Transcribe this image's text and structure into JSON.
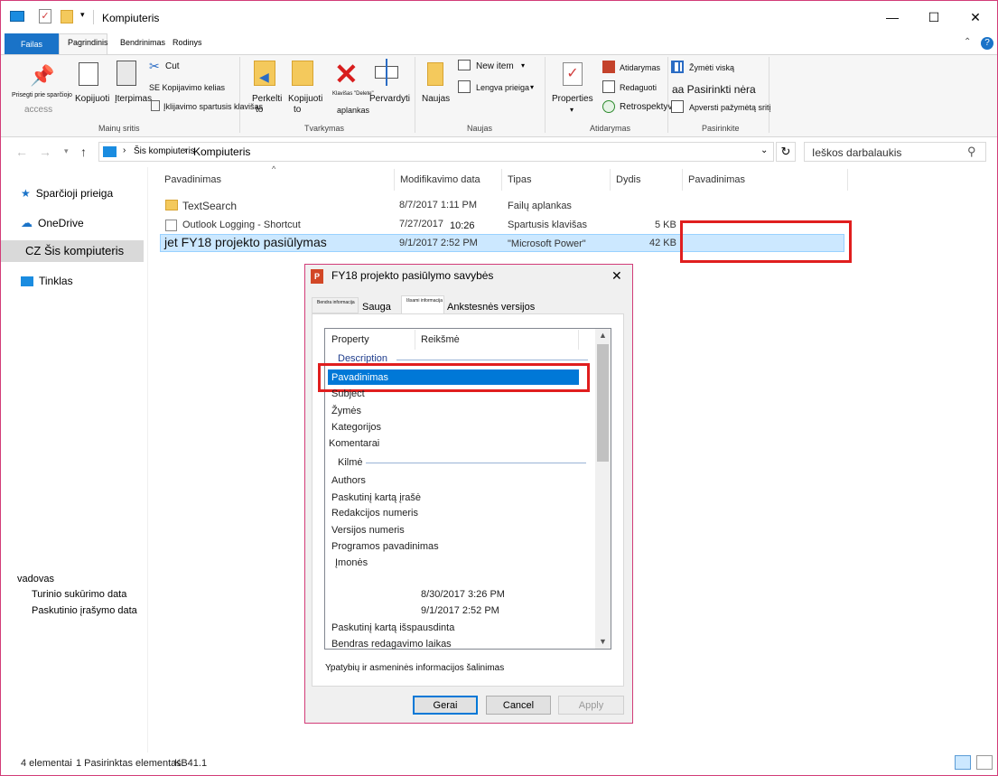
{
  "window": {
    "title": "Kompiuteris",
    "controls": {
      "minimize": "—",
      "maximize": "☐",
      "close": "✕"
    }
  },
  "ribbon_tabs": {
    "file": "Failas",
    "home": "Pagrindinis",
    "share": "Bendrinimas",
    "view": "Rodinys"
  },
  "ribbon": {
    "clipboard": {
      "pin_line1": "Prisegti prie sparčiojo",
      "pin_line2": "access",
      "copy": "Kopijuoti",
      "paste": "Įterpimas",
      "cut": "Cut",
      "copy_path": "SE Kopijavimo kelias",
      "paste_shortcut": "Įklijavimo spartusis klavišas",
      "label": "Mainų sritis"
    },
    "organize": {
      "move_l1": "Perkelti",
      "move_l2": "to",
      "copyto_l1": "Kopijuoti",
      "copyto_l2": "to",
      "delete_l1": "Klavišas \"Delete\"",
      "delete_l2": "aplankas",
      "rename": "Pervardyti",
      "label": "Tvarkymas"
    },
    "new": {
      "new_folder": "Naujas",
      "new_item": "New item",
      "easy_access": "Lengva prieiga",
      "label": "Naujas"
    },
    "open": {
      "properties": "Properties",
      "open": "Atidarymas",
      "edit": "Redaguoti",
      "history": "Retrospektyva",
      "label": "Atidarymas"
    },
    "select": {
      "select_all": "Žymėti viską",
      "select_none": "aa Pasirinkti nėra",
      "invert": "Apversti pažymėtą sritį",
      "label": "Pasirinkite"
    }
  },
  "address": {
    "path_root": "Šis kompiuteris",
    "path_current": "Kompiuteris",
    "search_placeholder": "Ieškos darbalaukis"
  },
  "nav": {
    "quick": "Sparčioji prieiga",
    "onedrive": "OneDrive",
    "thispc": "CZ Šis kompiuteris",
    "network": "Tinklas",
    "extra_header": "vadovas",
    "extra_1": "Turinio sukūrimo data",
    "extra_2": "Paskutinio įrašymo data"
  },
  "columns": [
    "Pavadinimas",
    "Modifikavimo data",
    "Tipas",
    "Dydis",
    "Pavadinimas"
  ],
  "files": [
    {
      "name": "TextSearch",
      "date": "8/7/2017 1:11 PM",
      "type": "Failų aplankas",
      "size": ""
    },
    {
      "name": "Outlook Logging - Shortcut",
      "date": "7/27/2017",
      "time": "10:26",
      "type": "Spartusis klavišas",
      "size": "5 KB"
    },
    {
      "name": "jet FY18 projekto pasiūlymas",
      "date": "9/1/2017 2:52 PM",
      "type": "\"Microsoft Power\"",
      "size": "42 KB"
    }
  ],
  "dialog": {
    "title": "FY18 projekto pasiūlymo savybės",
    "tabs": {
      "general": "Bendra informacija",
      "security": "Sauga",
      "details": "Išsami informacija",
      "previous": "Ankstesnės versijos"
    },
    "col_property": "Property",
    "col_value": "Reikšmė",
    "section_description": "Description",
    "section_origin": "Kilmė",
    "props": [
      "Pavadinimas",
      "Subject",
      "Žymės",
      "Kategorijos",
      "Komentarai"
    ],
    "origin_props": [
      "Authors",
      "Paskutinį kartą įrašė",
      "Redakcijos numeris",
      "Versijos numeris",
      "Programos pavadinimas",
      "Įmonės"
    ],
    "date_created": "8/30/2017 3:26 PM",
    "date_saved": "9/1/2017 2:52 PM",
    "last_printed": "Paskutinį kartą išspausdinta",
    "editing_time": "Bendras redagavimo laikas",
    "remove_link": "Ypatybių ir asmeninės informacijos šalinimas",
    "ok": "Gerai",
    "cancel": "Cancel",
    "apply": "Apply"
  },
  "status": {
    "items": "4 elementai",
    "selected": "1 Pasirinktas elementas",
    "size": "KB41.1"
  },
  "colors": {
    "accent": "#1a73c8",
    "selection": "#cce8ff",
    "highlight": "#0078d7",
    "redbox": "#e01e1e"
  }
}
